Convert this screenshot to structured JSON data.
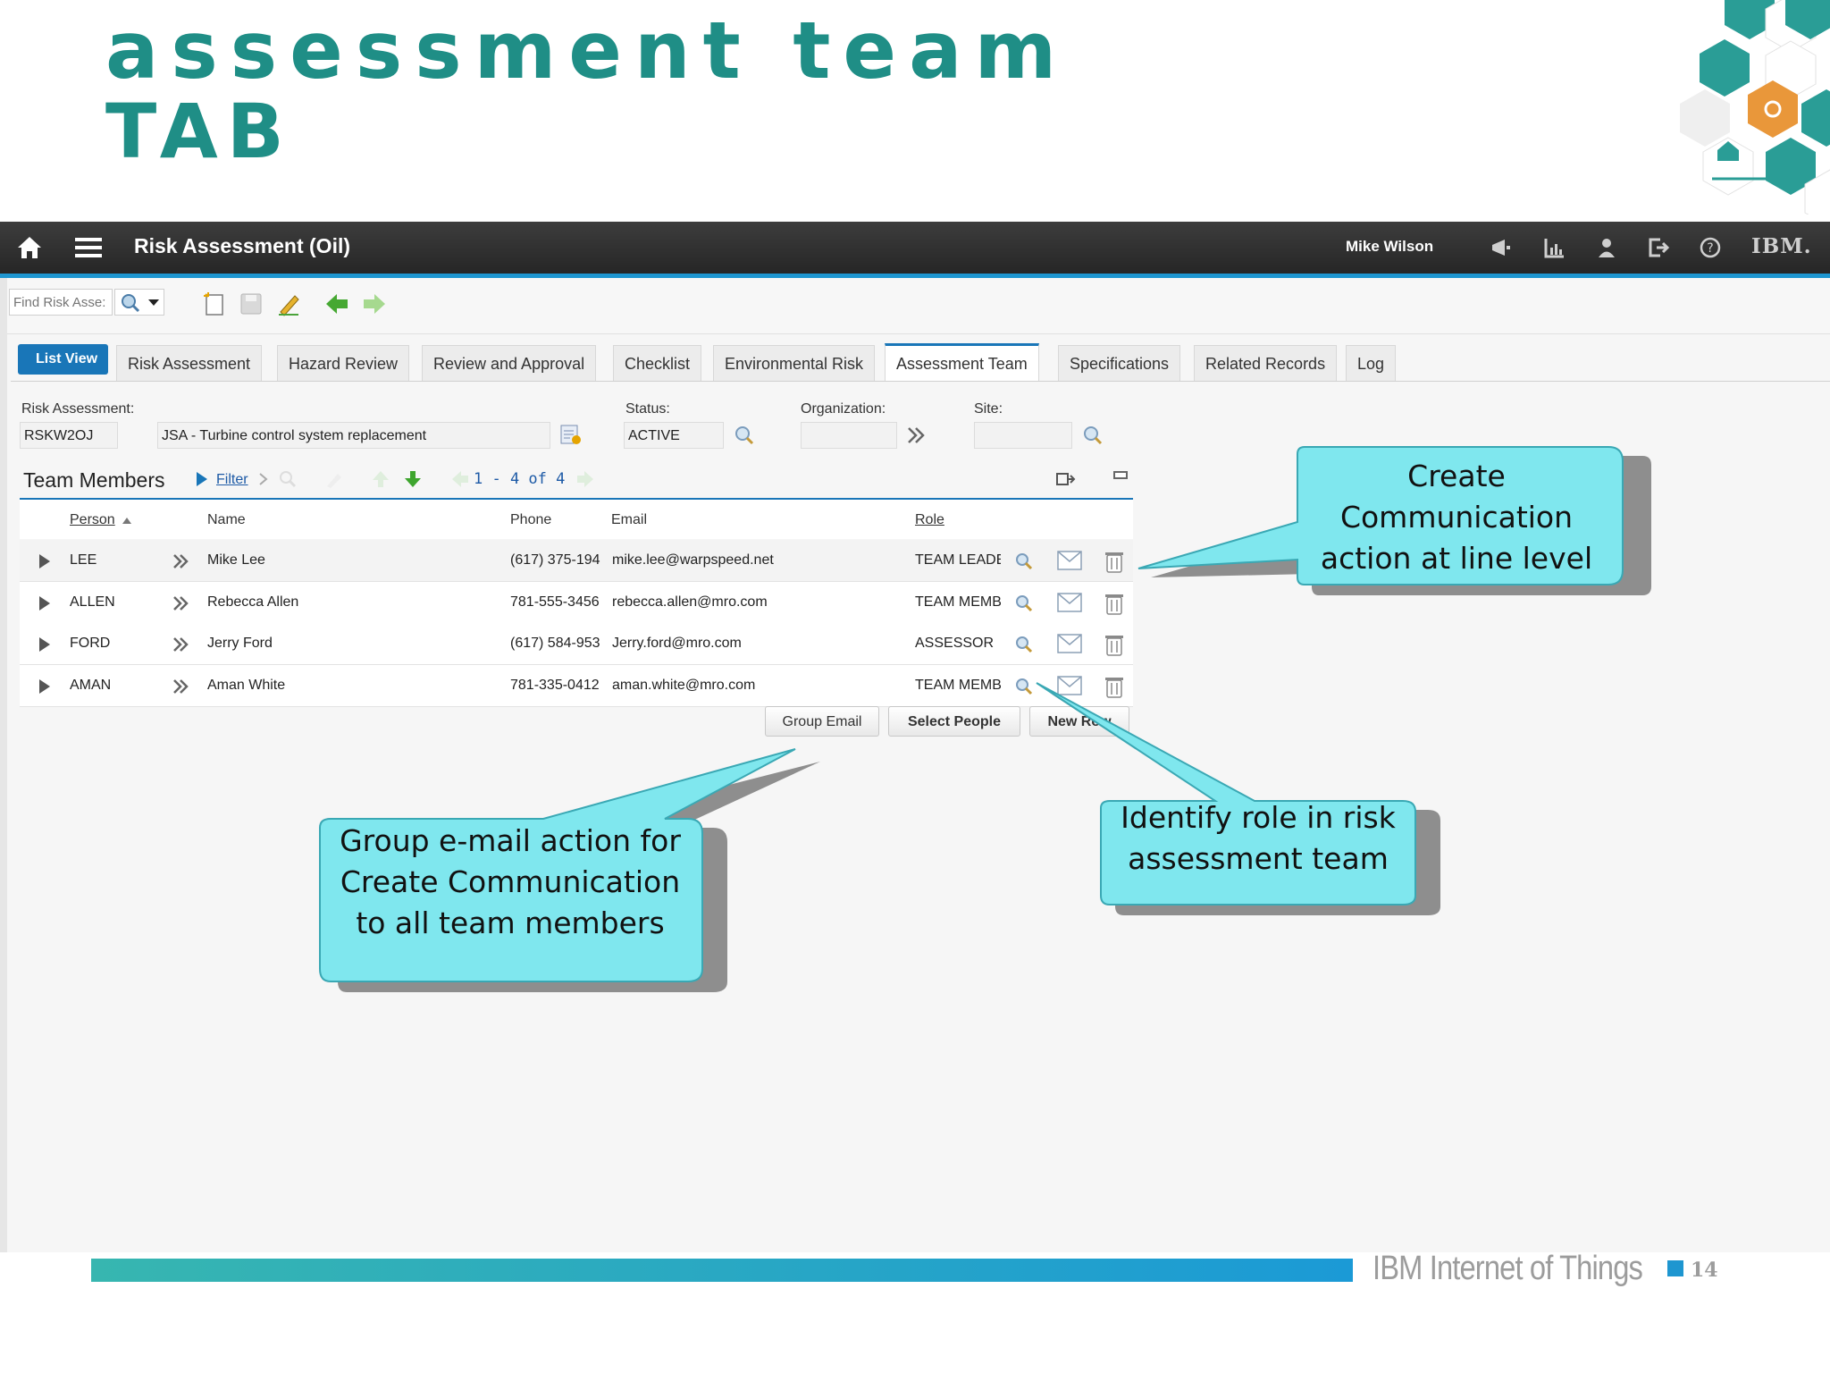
{
  "slide": {
    "title_line1": "assessment team",
    "title_line2": "TAB",
    "footer_text": "IBM Internet of Things",
    "page_number": "14"
  },
  "app": {
    "title": "Risk Assessment (Oil)",
    "user": "Mike Wilson",
    "logo": "IBM.",
    "accent": "#1976b8"
  },
  "toolbar": {
    "find_placeholder": "Find Risk Asse:"
  },
  "tabs": {
    "list_view": "List View",
    "items": [
      "Risk Assessment",
      "Hazard Review",
      "Review and Approval",
      "Checklist",
      "Environmental Risk",
      "Assessment Team",
      "Specifications",
      "Related Records",
      "Log"
    ],
    "active": "Assessment Team"
  },
  "form": {
    "risk_assessment_label": "Risk Assessment:",
    "risk_assessment_id": "RSKW2OJ",
    "risk_assessment_desc": "JSA - Turbine control system replacement",
    "status_label": "Status:",
    "status_value": "ACTIVE",
    "organization_label": "Organization:",
    "organization_value": "",
    "site_label": "Site:",
    "site_value": ""
  },
  "team": {
    "title": "Team Members",
    "filter": "Filter",
    "pager": "1 - 4 of 4",
    "columns": [
      "Person",
      "Name",
      "Phone",
      "Email",
      "Role"
    ],
    "rows": [
      {
        "person": "LEE",
        "name": "Mike Lee",
        "phone": "(617) 375-194",
        "email": "mike.lee@warpspeed.net",
        "role": "TEAM LEADE"
      },
      {
        "person": "ALLEN",
        "name": "Rebecca Allen",
        "phone": "781-555-3456",
        "email": "rebecca.allen@mro.com",
        "role": "TEAM MEMBI"
      },
      {
        "person": "FORD",
        "name": "Jerry Ford",
        "phone": "(617) 584-953",
        "email": "Jerry.ford@mro.com",
        "role": "ASSESSOR"
      },
      {
        "person": "AMAN",
        "name": "Aman White",
        "phone": "781-335-0412",
        "email": "aman.white@mro.com",
        "role": "TEAM MEMBI"
      }
    ],
    "buttons": {
      "group_email": "Group Email",
      "select_people": "Select People",
      "new_row": "New Row"
    }
  },
  "callouts": {
    "line_level": "Create Communication action at line level",
    "group_email": "Group e-mail action for Create Communication to all team members",
    "role": "Identify role in risk assessment team"
  }
}
